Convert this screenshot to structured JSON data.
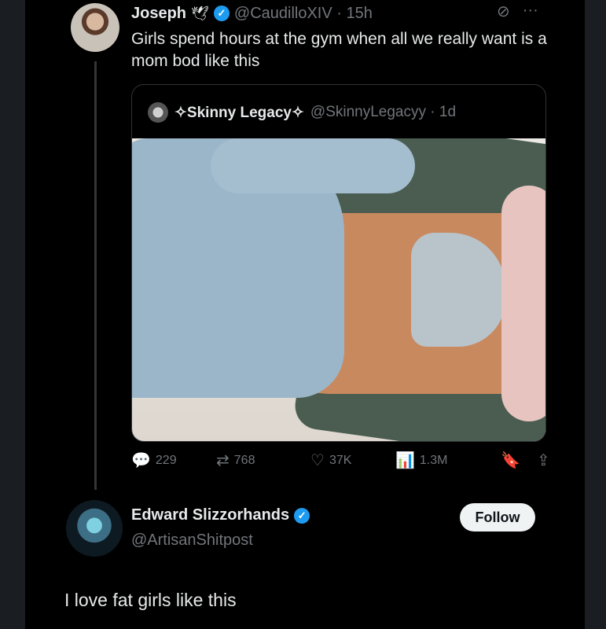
{
  "post": {
    "display_name": "Joseph",
    "name_emoji": "🕊",
    "handle_time": "@CaudilloXIV · 15h",
    "text": "Girls spend hours at the gym when all we really want is a mom bod like this",
    "grok_icon": "⊘",
    "more_icon": "···"
  },
  "quote": {
    "display_name": "✧Skinny Legacy✧",
    "handle_time": "@SkinnyLegacyy · 1d"
  },
  "actions": {
    "replies": "229",
    "reposts": "768",
    "likes": "37K",
    "views": "1.3M",
    "icons": {
      "reply": "💬",
      "repost": "⇄",
      "like": "♡",
      "views": "📊",
      "bookmark": "🔖",
      "share": "⇪"
    }
  },
  "reply": {
    "display_name": "Edward Slizzorhands",
    "handle": "@ArtisanShitpost",
    "follow_label": "Follow",
    "text": "I love fat girls like this"
  },
  "colors": {
    "background": "#000000",
    "verified": "#1d9bf0",
    "muted": "#71767b"
  }
}
